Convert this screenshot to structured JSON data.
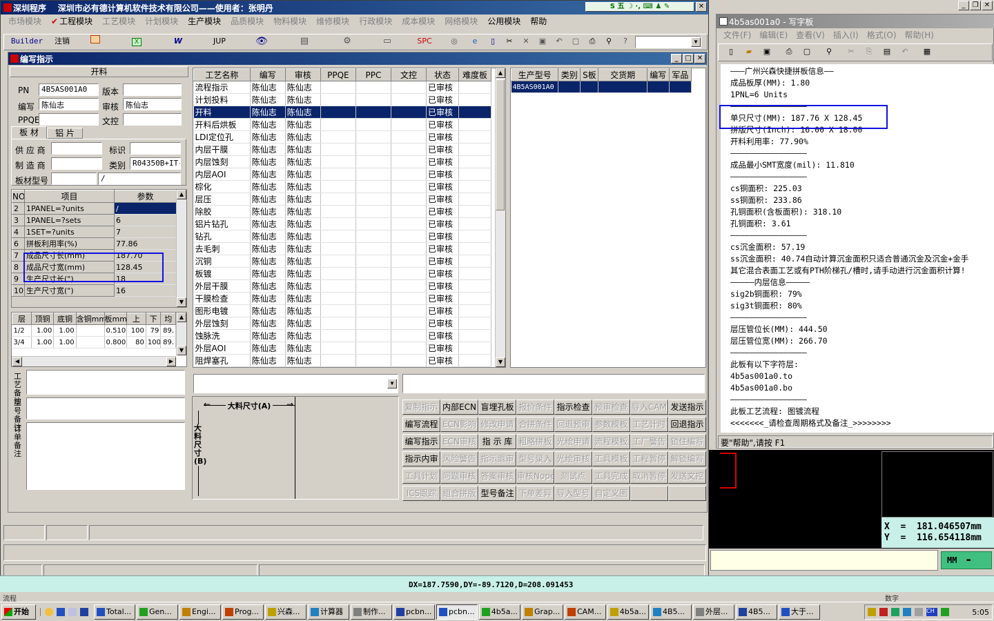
{
  "main_window": {
    "title": "深圳程序    深圳市必有德计算机软件技术有限公司——使用者：张明丹",
    "menu": [
      "市场模块",
      "工程模块",
      "工艺模块",
      "计划模块",
      "生产模块",
      "品质模块",
      "物料模块",
      "维修模块",
      "行政模块",
      "成本模块",
      "网络模块",
      "公用模块",
      "帮助"
    ],
    "menu_enabled": [
      "工程模块",
      "生产模块",
      "公用模块",
      "帮助"
    ],
    "toolbar": [
      "Builder",
      "注销",
      "",
      "",
      "W",
      "JUP",
      "",
      "",
      "",
      "",
      "SPC"
    ]
  },
  "sub_window": {
    "title": "编写指示",
    "section_title": "开料",
    "pn_label": "PN",
    "pn_value": "4B5AS001A0",
    "version_label": "版本",
    "version_value": "",
    "writer_label": "编写",
    "writer_value": "陈仙志",
    "reviewer_label": "审核",
    "reviewer_value": "陈仙志",
    "ppqe_label": "PPQE",
    "ppqe_value": "",
    "doc_label": "文控",
    "doc_value": "",
    "tab1": "板 材",
    "tab2": "铝 片",
    "supplier_label": "供 应 商",
    "supplier_value": "",
    "mark_label": "标识",
    "mark_value": "",
    "maker_label": "制 造 商",
    "maker_value": "",
    "category_label": "类别",
    "category_value": "R04350B+IT-",
    "board_model_label": "板材型号",
    "board_model_value": "",
    "board_model_value2": "/",
    "params_headers": [
      "NO",
      "项目",
      "参数"
    ],
    "params": [
      [
        "2",
        "1PANEL=?units",
        "/"
      ],
      [
        "3",
        "1PANEL=?sets",
        "6"
      ],
      [
        "4",
        "1SET=?units",
        "7"
      ],
      [
        "6",
        "拼板利用率(%)",
        "77.86"
      ],
      [
        "7",
        "成品尺寸长(mm)",
        "187.70"
      ],
      [
        "8",
        "成品尺寸宽(mm)",
        "128.45"
      ],
      [
        "9",
        "生产尺寸长(\")",
        "18"
      ],
      [
        "10",
        "生产尺寸宽(\")",
        "16"
      ]
    ],
    "layer_headers": [
      "层",
      "顶铜",
      "底铜",
      "含铜mm",
      "板mm",
      "上",
      "下",
      "均"
    ],
    "layers": [
      [
        "1/2",
        "1.00",
        "1.00",
        "",
        "0.510",
        "100",
        "79",
        "89."
      ],
      [
        "3/4",
        "1.00",
        "1.00",
        "",
        "0.800",
        "80",
        "100",
        "89."
      ]
    ],
    "craft_note_label": "工艺备注",
    "model_note_label": "型号备注",
    "order_note_label": "订单备注",
    "process_headers": [
      "工艺名称",
      "编写",
      "审核",
      "PPQE",
      "PPC",
      "文控",
      "状态",
      "难度板"
    ],
    "process_rows": [
      [
        "流程指示",
        "陈仙志",
        "陈仙志",
        "",
        "",
        "",
        "已审核",
        ""
      ],
      [
        "计划投料",
        "陈仙志",
        "陈仙志",
        "",
        "",
        "",
        "已审核",
        ""
      ],
      [
        "开料",
        "陈仙志",
        "陈仙志",
        "",
        "",
        "",
        "已审核",
        ""
      ],
      [
        "开料后烘板",
        "陈仙志",
        "陈仙志",
        "",
        "",
        "",
        "已审核",
        ""
      ],
      [
        "LDI定位孔",
        "陈仙志",
        "陈仙志",
        "",
        "",
        "",
        "已审核",
        ""
      ],
      [
        "内层干膜",
        "陈仙志",
        "陈仙志",
        "",
        "",
        "",
        "已审核",
        ""
      ],
      [
        "内层蚀刻",
        "陈仙志",
        "陈仙志",
        "",
        "",
        "",
        "已审核",
        ""
      ],
      [
        "内层AOI",
        "陈仙志",
        "陈仙志",
        "",
        "",
        "",
        "已审核",
        ""
      ],
      [
        "棕化",
        "陈仙志",
        "陈仙志",
        "",
        "",
        "",
        "已审核",
        ""
      ],
      [
        "层压",
        "陈仙志",
        "陈仙志",
        "",
        "",
        "",
        "已审核",
        ""
      ],
      [
        "除胶",
        "陈仙志",
        "陈仙志",
        "",
        "",
        "",
        "已审核",
        ""
      ],
      [
        "铝片钻孔",
        "陈仙志",
        "陈仙志",
        "",
        "",
        "",
        "已审核",
        ""
      ],
      [
        "钻孔",
        "陈仙志",
        "陈仙志",
        "",
        "",
        "",
        "已审核",
        ""
      ],
      [
        "去毛刺",
        "陈仙志",
        "陈仙志",
        "",
        "",
        "",
        "已审核",
        ""
      ],
      [
        "沉铜",
        "陈仙志",
        "陈仙志",
        "",
        "",
        "",
        "已审核",
        ""
      ],
      [
        "板镀",
        "陈仙志",
        "陈仙志",
        "",
        "",
        "",
        "已审核",
        ""
      ],
      [
        "外层干膜",
        "陈仙志",
        "陈仙志",
        "",
        "",
        "",
        "已审核",
        ""
      ],
      [
        "干膜检查",
        "陈仙志",
        "陈仙志",
        "",
        "",
        "",
        "已审核",
        ""
      ],
      [
        "图形电镀",
        "陈仙志",
        "陈仙志",
        "",
        "",
        "",
        "已审核",
        ""
      ],
      [
        "外层蚀刻",
        "陈仙志",
        "陈仙志",
        "",
        "",
        "",
        "已审核",
        ""
      ],
      [
        "蚀脉洗",
        "陈仙志",
        "陈仙志",
        "",
        "",
        "",
        "已审核",
        ""
      ],
      [
        "外层AOI",
        "陈仙志",
        "陈仙志",
        "",
        "",
        "",
        "已审核",
        ""
      ],
      [
        "阻焊塞孔",
        "陈仙志",
        "陈仙志",
        "",
        "",
        "",
        "已审核",
        ""
      ],
      [
        "阻焊",
        "陈仙志",
        "陈仙志",
        "",
        "",
        "",
        "已审核",
        ""
      ]
    ],
    "selected_process": 2,
    "model_headers": [
      "生产型号",
      "类别",
      "S板",
      "交货期",
      "编写",
      "军品"
    ],
    "model_rows": [
      [
        "4B5AS001A0",
        "",
        "",
        "",
        "",
        ""
      ]
    ],
    "dim_a_label": "大料尺寸(A)",
    "dim_b_label": "大料尺寸(B)",
    "buttons": [
      [
        "复制指示",
        false
      ],
      [
        "内部ECN",
        true
      ],
      [
        "盲埋孔板",
        true
      ],
      [
        "报价条件",
        false
      ],
      [
        "指示检查",
        true
      ],
      [
        "预审检查",
        false
      ],
      [
        "导入CAM",
        false
      ],
      [
        "发送指示",
        true
      ],
      [
        "编写流程",
        true
      ],
      [
        "ECN影响",
        false
      ],
      [
        "修改申请",
        false
      ],
      [
        "合拼条件",
        false
      ],
      [
        "回退预审",
        false
      ],
      [
        "参数模板",
        false
      ],
      [
        "工艺计时",
        false
      ],
      [
        "回退指示",
        true
      ],
      [
        "编写指示",
        true
      ],
      [
        "ECN审核",
        false
      ],
      [
        "指 示 库",
        true
      ],
      [
        "粗略拼板",
        false
      ],
      [
        "光绘申请",
        false
      ],
      [
        "流程模板",
        false
      ],
      [
        "工厂警告",
        false
      ],
      [
        "锁住编写",
        false
      ],
      [
        "指示内审",
        true
      ],
      [
        "风险警告",
        false
      ],
      [
        "指示退审",
        false
      ],
      [
        "型号录入",
        false
      ],
      [
        "光绘审核",
        false
      ],
      [
        "工具模板",
        false
      ],
      [
        "工程暂停",
        false
      ],
      [
        "解锁编写",
        false
      ],
      [
        "工具计划",
        false
      ],
      [
        "问题审核",
        false
      ],
      [
        "答案审核",
        false
      ],
      [
        "审核Nope",
        false
      ],
      [
        "测试点",
        false
      ],
      [
        "工具完成",
        false
      ],
      [
        "取消暂停",
        false
      ],
      [
        "发送文控",
        false
      ],
      [
        "ICS跟踪",
        false
      ],
      [
        "组合拼版",
        false
      ],
      [
        "型号备注",
        true
      ],
      [
        "下单差异",
        false
      ],
      [
        "导入型号",
        false
      ],
      [
        "自定义图",
        false
      ],
      [
        "",
        false
      ],
      [
        "",
        false
      ]
    ]
  },
  "notepad": {
    "title": "4b5as001a0 - 写字板",
    "menu": [
      "文件(F)",
      "编辑(E)",
      "查看(V)",
      "插入(I)",
      "格式(O)",
      "帮助(H)"
    ],
    "lines": [
      "———广州兴森快捷拼板信息——",
      "成品板厚(MM): 1.80",
      "1PNL=6 Units",
      "————————————————",
      "单只尺寸(MM): 187.76 X 128.45",
      "拼版尺寸(Inch): 16.00 X 18.00",
      "开料利用率: 77.90%",
      "————————————————",
      "成品最小SMT宽度(mil): 11.810",
      "————————————————",
      "cs铜面积: 225.03",
      "ss铜面积: 233.86",
      "孔铜面积(含板面积): 318.10",
      "孔铜面积: 3.61",
      "————————————————",
      "cs沉金面积: 57.19",
      "ss沉金面积: 40.74自动计算沉金面积只适合普通沉金及沉金+金手",
      "其它混合表面工艺或有PTH阶梯孔/槽时,请手动进行沉金面积计算!",
      "—————内层信息—————",
      "sig2b铜面积: 79%",
      "sig3t铜面积: 80%",
      "————————————————",
      "层压管位长(MM): 444.50",
      "层压管位宽(MM): 266.70",
      "————————————————",
      "此板有以下字符层:",
      "4b5as001a0.to",
      "4b5as001a0.bo",
      "————————————————",
      "此板工艺流程: 图镀流程",
      "<<<<<<<_请检查周期格式及备注_>>>>>>>>"
    ],
    "status": "要\"帮助\",请按 F1"
  },
  "cam": {
    "x_readout": "X  =  181.046507mm",
    "y_readout": "Y  =  116.654118mm",
    "unit": "MM",
    "status_line": "DX=187.7590,DY=-89.7120,D=208.091453",
    "left_hint": "流程",
    "right_hint": "数字"
  },
  "taskbar": {
    "start": "开始",
    "tasks": [
      "Total...",
      "Gen...",
      "Engi...",
      "Prog...",
      "兴森...",
      "计算器",
      "制作...",
      "pcbn...",
      "pcbn...",
      "4b5a...",
      "Grap...",
      "CAM...",
      "4b5a...",
      "4B5...",
      "外层...",
      "4B5...",
      "大于..."
    ],
    "active_task": 8,
    "clock": "5:05"
  },
  "colors": {
    "title_active": "#0a246a",
    "selection": "#0a246a",
    "highlight_box": "#1010e0",
    "cam_bg": "#000000",
    "cam_readout_bg": "#c8f0e8"
  }
}
